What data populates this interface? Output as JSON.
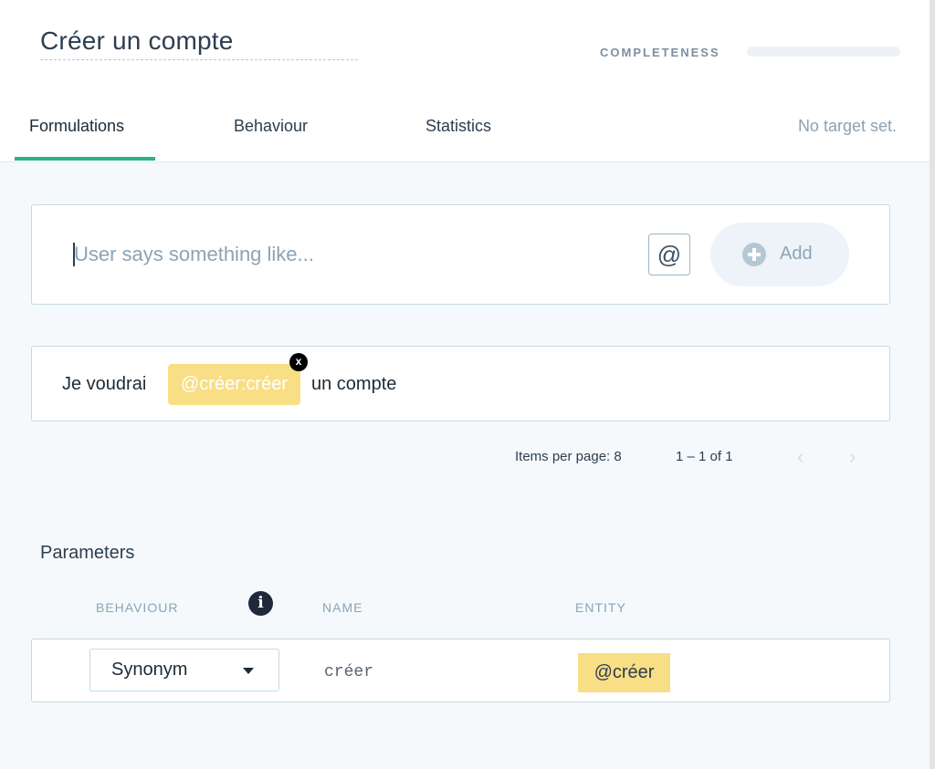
{
  "intent": {
    "title": "Créer un compte",
    "completeness_label": "COMPLETENESS",
    "completeness_value": 0
  },
  "tabs": [
    {
      "label": "Formulations",
      "active": true
    },
    {
      "label": "Behaviour",
      "active": false
    },
    {
      "label": "Statistics",
      "active": false
    }
  ],
  "target_status": "No target set.",
  "input": {
    "placeholder": "User says something like...",
    "value": "",
    "at_label": "@",
    "add_label": "Add"
  },
  "formulations": [
    {
      "prefix": "Je voudrai",
      "entity": "@créer:créer",
      "suffix": "un compte",
      "remove_label": "x"
    }
  ],
  "pagination": {
    "items_per_page_label": "Items per page: 8",
    "range_label": "1 – 1 of 1",
    "prev_icon": "chevron-left-icon",
    "next_icon": "chevron-right-icon"
  },
  "parameters": {
    "title": "Parameters",
    "headers": {
      "behaviour": "BEHAVIOUR",
      "name": "NAME",
      "entity": "ENTITY"
    },
    "info_icon": "i",
    "rows": [
      {
        "behaviour": "Synonym",
        "name": "créer",
        "entity": "@créer"
      }
    ]
  },
  "colors": {
    "accent": "#2ab383",
    "entity_highlight": "#f8df85",
    "muted_text": "#8da2b2"
  }
}
